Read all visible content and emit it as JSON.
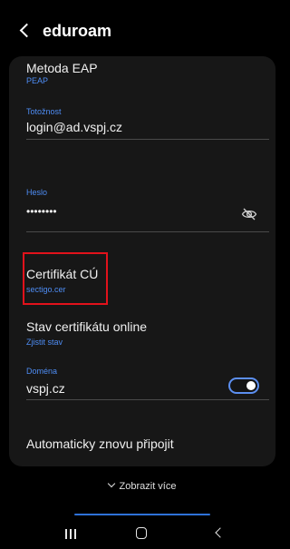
{
  "header": {
    "title": "eduroam",
    "back_icon": "chevron-left-icon"
  },
  "fields": {
    "eap": {
      "label": "Metoda EAP",
      "value": "PEAP"
    },
    "identity": {
      "label": "Totožnost",
      "value": "login@ad.vspj.cz"
    },
    "password": {
      "label": "Heslo",
      "value": "••••••••",
      "icon": "eye-off-icon"
    },
    "ca_cert": {
      "label": "Certifikát CÚ",
      "value": "sectigo.cer"
    },
    "online_cert": {
      "label": "Stav certifikátu online",
      "value": "Zjistit stav"
    },
    "domain": {
      "label": "Doména",
      "value": "vspj.cz"
    },
    "auto_reconnect": {
      "label": "Automaticky znovu připojit",
      "enabled": true
    }
  },
  "show_more": {
    "label": "Zobrazit více",
    "icon": "chevron-down-icon"
  },
  "colors": {
    "accent": "#4e8df5",
    "highlight": "#e1121b",
    "card": "#171717",
    "background": "#000000"
  },
  "navbar": {
    "icons": [
      "recent-apps-icon",
      "home-icon",
      "back-icon"
    ]
  }
}
